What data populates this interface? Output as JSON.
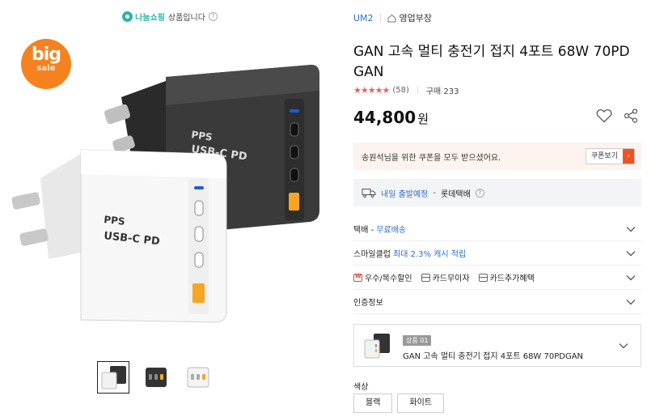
{
  "seller": {
    "logo_text": "나눔쇼핑",
    "label": "상품입니다",
    "help": "?"
  },
  "badge": {
    "big": "big",
    "sale": "sale"
  },
  "gallery": {
    "active_index": 0,
    "thumbs": [
      "thumb-1",
      "thumb-2",
      "thumb-3"
    ]
  },
  "crumbs": {
    "brand": "UM2",
    "store": "영업부장"
  },
  "product": {
    "title": "GAN 고속 멀티 충전기 접지 4포트 68W 70PD GAN",
    "stars": "★★★★★",
    "rating": 5,
    "review_count": "(58)",
    "purchase_label": "구매 233",
    "price": "44,800",
    "currency": "원"
  },
  "coupon": {
    "text": "송원석님을 위한 쿠폰을 모두 받으셨어요.",
    "button": "쿠폰보기",
    "arrow": "›"
  },
  "shipping": {
    "eta": "내일 출발예정",
    "dash": "-",
    "carrier": "롯데택배",
    "help": "?"
  },
  "rows": {
    "delivery": {
      "label": "택배 -",
      "value": "무료배송"
    },
    "smile": {
      "label": "스마일클럽",
      "value": "최대 2.3% 캐시 적립"
    },
    "benefits": [
      "우수/복수할인",
      "카드무이자",
      "카드추가혜택"
    ],
    "cert": {
      "label": "인증정보"
    }
  },
  "option": {
    "tag": "상품 01",
    "name": "GAN 고속 멀티 충전기 접지 4포트 68W 70PDGAN"
  },
  "color": {
    "label": "색상",
    "options": [
      "블랙",
      "화이트"
    ]
  },
  "colors": {
    "accent_blue": "#2f6fd6",
    "accent_orange": "#f4511e",
    "star_red": "#f55d5d",
    "badge_orange": "#f5821f"
  }
}
